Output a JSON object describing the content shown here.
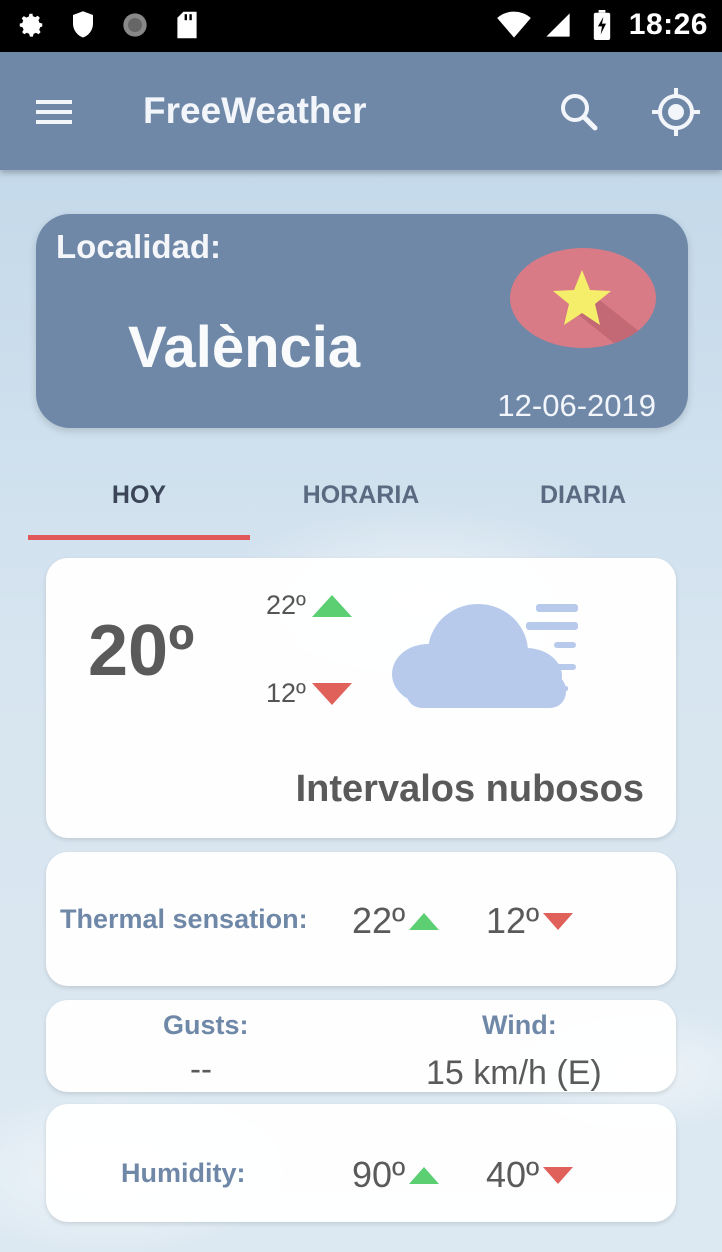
{
  "status_bar": {
    "time": "18:26",
    "icons": [
      "gear-icon",
      "shield-icon",
      "circle-icon",
      "sd-card-icon",
      "wifi-icon",
      "signal-icon",
      "battery-icon"
    ]
  },
  "app_bar": {
    "title": "FreeWeather",
    "icons": [
      "menu-icon",
      "search-icon",
      "my-location-icon"
    ]
  },
  "location": {
    "label": "Localidad:",
    "city": "València",
    "date": "12-06-2019",
    "favorite_icon": "star-icon"
  },
  "tabs": [
    {
      "label": "HOY",
      "active": true
    },
    {
      "label": "HORARIA",
      "active": false
    },
    {
      "label": "DIARIA",
      "active": false
    }
  ],
  "today": {
    "temperature": "20º",
    "max": "22º",
    "min": "12º",
    "condition": "Intervalos nubosos",
    "condition_icon": "cloud-wind-icon"
  },
  "thermal": {
    "label": "Thermal sensation:",
    "max": "22º",
    "min": "12º"
  },
  "gusts": {
    "label": "Gusts:",
    "value": "--"
  },
  "wind": {
    "label": "Wind:",
    "value": "15 km/h (E)"
  },
  "humidity": {
    "label": "Humidity:",
    "max": "90º",
    "min": "40º"
  },
  "colors": {
    "accent": "#6f88a8",
    "tab_indicator": "#e0585a",
    "up": "#5ccf73",
    "down": "#e0605a",
    "favorite": "#d97b86",
    "star": "#f5ee6a"
  }
}
